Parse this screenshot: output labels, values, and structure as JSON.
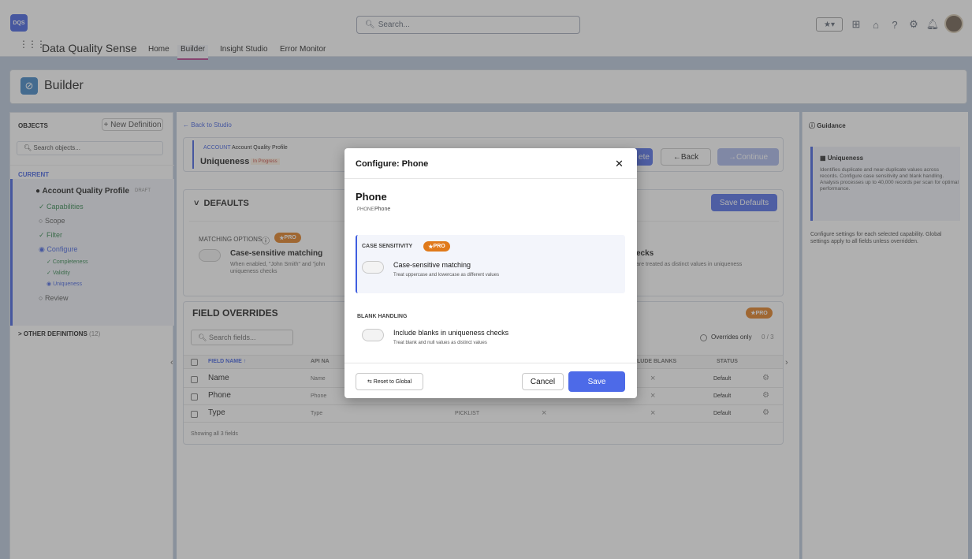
{
  "app": {
    "logo": "DQS",
    "name": "Data Quality Sense",
    "search_placeholder": "Search...",
    "nav": [
      "Home",
      "Builder",
      "Insight Studio",
      "Error Monitor"
    ]
  },
  "icons": [
    "star-icon",
    "add-icon",
    "trailhead-icon",
    "help-icon",
    "settings-icon",
    "bell-icon"
  ],
  "header": {
    "title": "Builder"
  },
  "sidebar": {
    "objects_label": "OBJECTS",
    "new_def": "+ New Definition",
    "search_placeholder": "Search objects...",
    "current_label": "CURRENT",
    "profile": "Account Quality Profile",
    "profile_badge": "DRAFT",
    "items": [
      {
        "label": "Capabilities",
        "state": "done"
      },
      {
        "label": "Scope",
        "state": "pending"
      },
      {
        "label": "Filter",
        "state": "done"
      },
      {
        "label": "Configure",
        "state": "active"
      }
    ],
    "sub_items": [
      "Completeness",
      "Validity",
      "Uniqueness"
    ],
    "review": "Review",
    "other": "OTHER DEFINITIONS",
    "other_count": "(12)"
  },
  "main": {
    "back": "Back to Studio",
    "object_tag": "ACCOUNT",
    "profile": "Account Quality Profile",
    "capability": "Uniqueness",
    "status": "In Progress",
    "btn_partial": "ete",
    "btn_back": "Back",
    "btn_continue": "Continue",
    "defaults": "DEFAULTS",
    "save_defaults": "Save Defaults",
    "matching_options": "MATCHING OPTIONS",
    "pro": "PRO",
    "case_title": "Case-sensitive matching",
    "case_desc_a": "When enabled, \"John Smith\" and \"john",
    "case_desc_b": "uniqueness checks",
    "blank_partial": "ecks",
    "blank_desc_partial": "are treated as distinct values in uniqueness",
    "overrides": "FIELD OVERRIDES",
    "search_fields": "Search fields...",
    "overrides_only": "Overrides only",
    "overrides_count": "0 / 3",
    "columns": [
      "FIELD NAME",
      "API NA",
      "",
      "",
      "LUDE BLANKS",
      "STATUS"
    ],
    "rows": [
      {
        "name": "Name",
        "api": "Name",
        "type": "",
        "v1": "",
        "v2": "×",
        "status": "Default"
      },
      {
        "name": "Phone",
        "api": "Phone",
        "type": "",
        "v1": "",
        "v2": "×",
        "status": "Default"
      },
      {
        "name": "Type",
        "api": "Type",
        "type": "PICKLIST",
        "v1": "×",
        "v2": "×",
        "status": "Default"
      }
    ],
    "showing": "Showing all 3 fields"
  },
  "guidance": {
    "title": "Guidance",
    "card_title": "Uniqueness",
    "card_text": "Identifies duplicate and near-duplicate values across records. Configure case sensitivity and blank handling. Analysis processes up to 40,000 records per scan for optimal performance.",
    "note": "Configure settings for each selected capability. Global settings apply to all fields unless overridden."
  },
  "modal": {
    "title": "Configure: Phone",
    "field": "Phone",
    "field_tag": "PHONE",
    "field_api": "Phone",
    "case_section": "CASE SENSITIVITY",
    "pro": "PRO",
    "case_label": "Case-sensitive matching",
    "case_desc": "Treat uppercase and lowercase as different values",
    "blank_section": "BLANK HANDLING",
    "blank_label": "Include blanks in uniqueness checks",
    "blank_desc": "Treat blank and null values as distinct values",
    "reset": "Reset to Global",
    "cancel": "Cancel",
    "save": "Save"
  }
}
